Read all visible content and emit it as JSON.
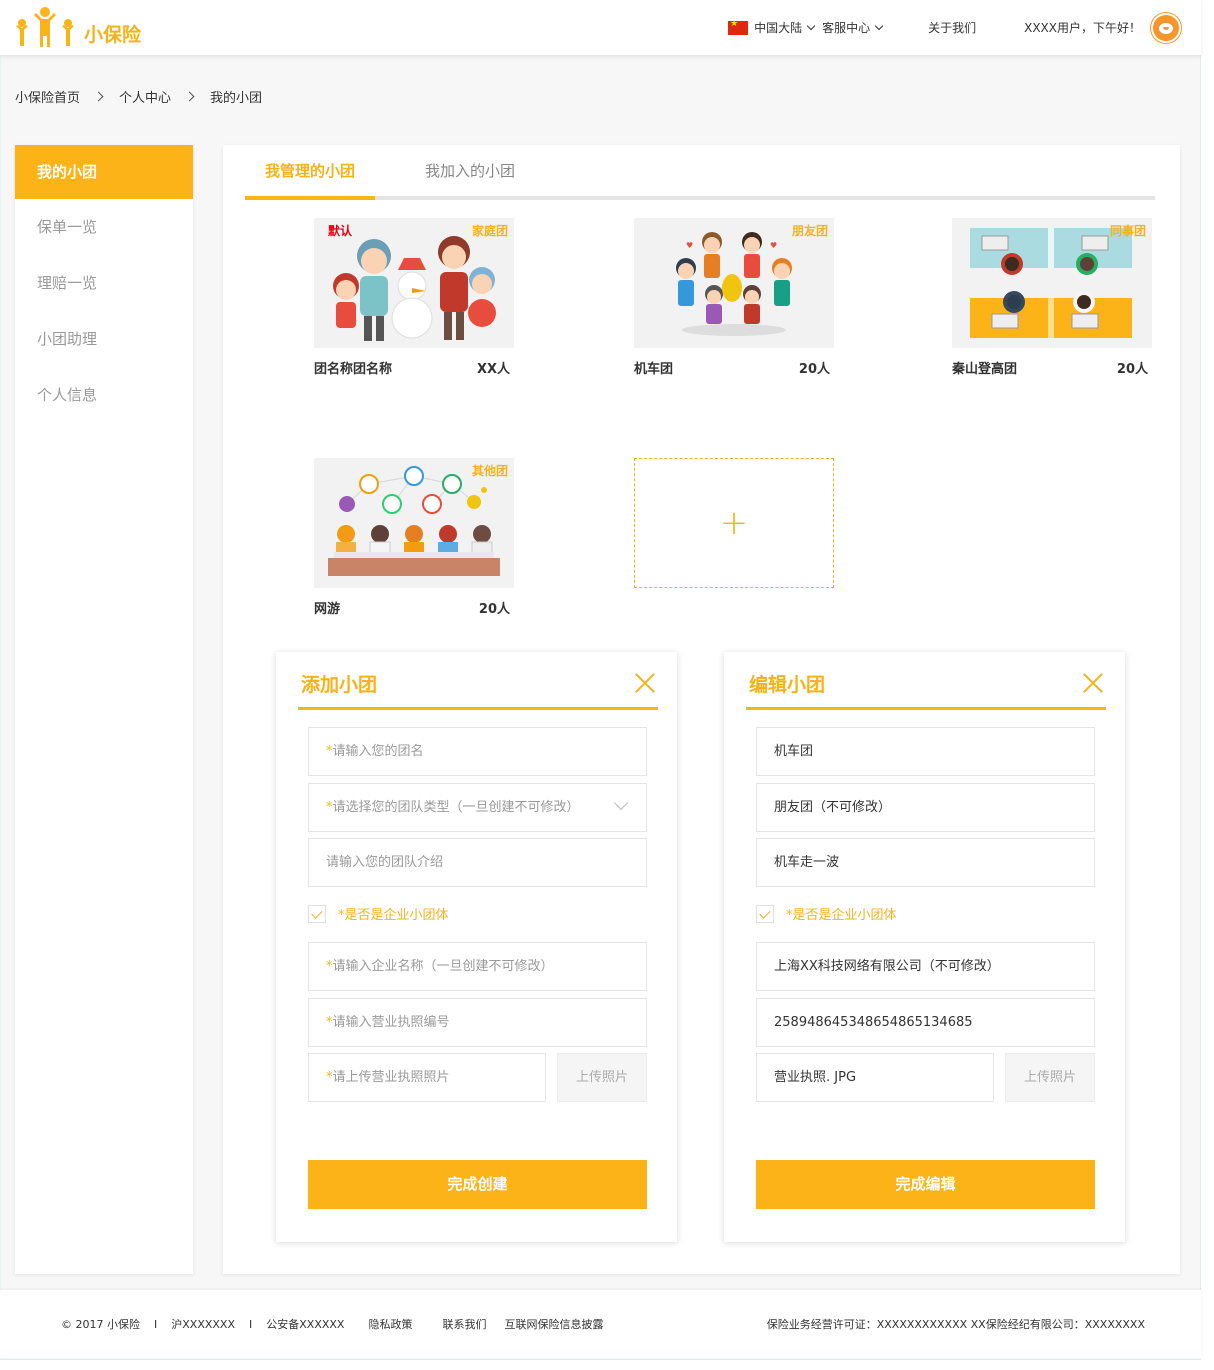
{
  "header": {
    "brand": "小保险",
    "region": "中国大陆",
    "service": "客服中心",
    "about": "关于我们",
    "greeting": "XXXX用户，下午好！",
    "colors": {
      "accent": "#fbb318",
      "brand_text": "#f6b21a",
      "default_tag": "#e60012"
    }
  },
  "breadcrumb": [
    "小保险首页",
    "个人中心",
    "我的小团"
  ],
  "sidebar": {
    "items": [
      {
        "label": "我的小团",
        "active": true
      },
      {
        "label": "保单一览",
        "active": false
      },
      {
        "label": "理赔一览",
        "active": false
      },
      {
        "label": "小团助理",
        "active": false
      },
      {
        "label": "个人信息",
        "active": false
      }
    ]
  },
  "tabs": [
    {
      "label": "我管理的小团",
      "active": true
    },
    {
      "label": "我加入的小团",
      "active": false
    }
  ],
  "groups": [
    {
      "name": "团名称团名称",
      "count": "XX人",
      "tag": "家庭团",
      "default_label": "默认"
    },
    {
      "name": "机车团",
      "count": "20人",
      "tag": "朋友团"
    },
    {
      "name": "秦山登高团",
      "count": "20人",
      "tag": "同事团"
    },
    {
      "name": "网游",
      "count": "20人",
      "tag": "其他团"
    }
  ],
  "add_card": {
    "icon": "plus-icon",
    "symbol": "+"
  },
  "add_dialog": {
    "title": "添加小团",
    "required_mark": "*",
    "name_placeholder": "请输入您的团名",
    "type_placeholder": "请选择您的团队类型（一旦创建不可修改）",
    "intro_placeholder": "请输入您的团队介绍",
    "enterprise_label": "*是否是企业小团体",
    "company_placeholder": "请输入企业名称（一旦创建不可修改）",
    "license_no_placeholder": "请输入营业执照编号",
    "license_photo_placeholder": "请上传营业执照照片",
    "upload_label": "上传照片",
    "submit_label": "完成创建"
  },
  "edit_dialog": {
    "title": "编辑小团",
    "name_value": "机车团",
    "type_value": "朋友团（不可修改）",
    "intro_value": "机车走一波",
    "enterprise_label": "*是否是企业小团体",
    "company_value": "上海XX科技网络有限公司（不可修改）",
    "license_no_value": "2589486453486548651346‌85",
    "license_photo_value": "营业执照. JPG",
    "upload_label": "上传照片",
    "submit_label": "完成编辑"
  },
  "footer": {
    "copyright": "© 2017 小保险",
    "sep": "I",
    "icp": "沪XXXXXXX",
    "police": "公安备XXXXXX",
    "privacy": "隐私政策",
    "contact": "联系我们",
    "disclosure": "互联网保险信息披露",
    "license": "保险业务经营许可证：XXXXXXXXXXXX XX保险经纪有限公司：XXXXXXXX"
  }
}
